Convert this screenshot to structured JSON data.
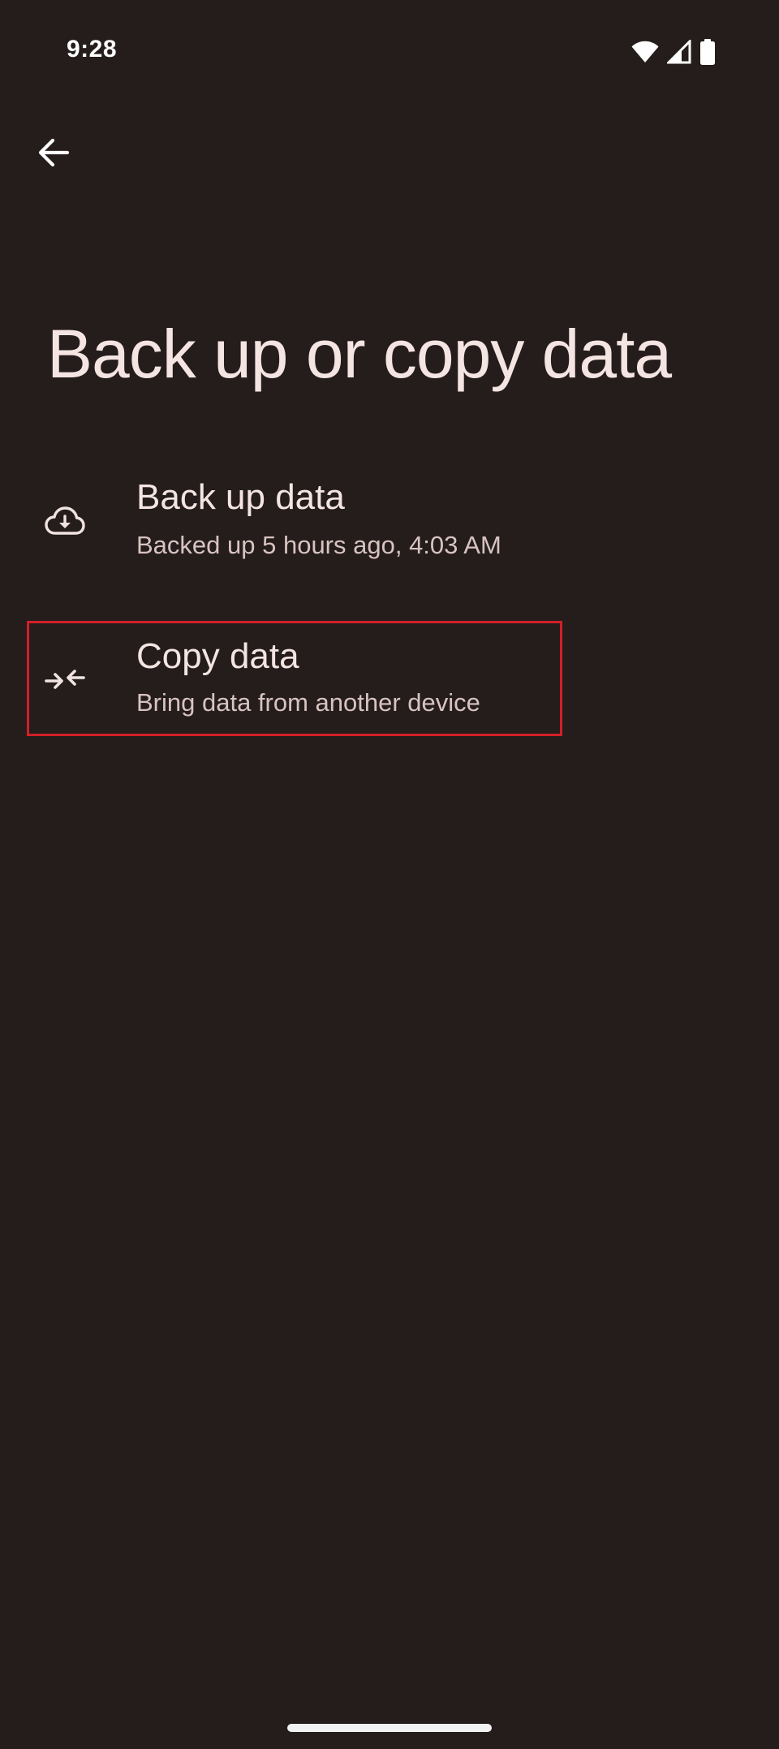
{
  "status_bar": {
    "time": "9:28",
    "icons": [
      "wifi-icon",
      "cellular-signal-icon",
      "battery-icon"
    ]
  },
  "navigation": {
    "back_icon": "arrow-left-icon"
  },
  "page": {
    "title": "Back up or copy data"
  },
  "items": [
    {
      "icon": "cloud-download-icon",
      "title": "Back up data",
      "subtitle": "Backed up 5 hours ago, 4:03 AM"
    },
    {
      "icon": "arrows-converge-icon",
      "title": "Copy data",
      "subtitle": "Bring data from another device",
      "highlighted": true
    }
  ],
  "colors": {
    "background": "#241d1c",
    "text_primary": "#f4e4e2",
    "text_secondary": "#d8c3c1",
    "highlight_outline": "#d32027"
  }
}
